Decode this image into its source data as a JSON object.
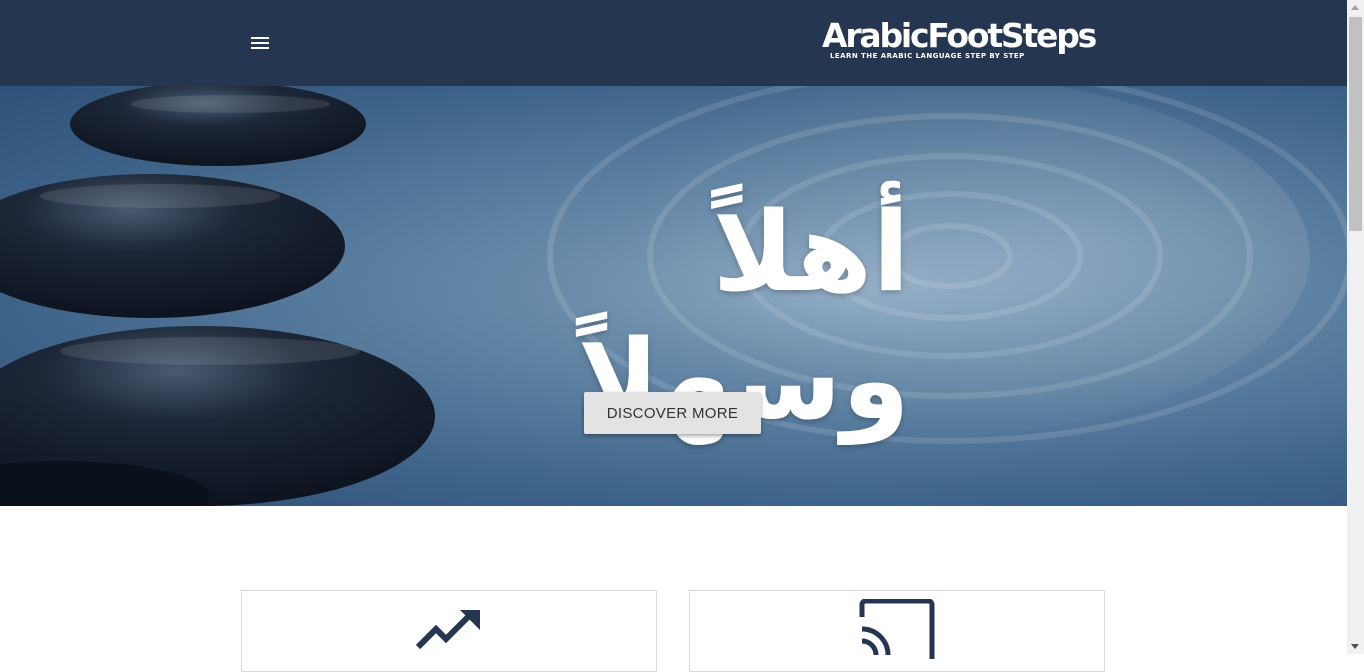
{
  "header": {
    "brand_name": "ArabicFootSteps",
    "brand_tagline": "LEARN THE ARABIC LANGUAGE STEP BY STEP",
    "menu_icon": "hamburger-menu-icon",
    "background_color": "#243650"
  },
  "hero": {
    "calligraphy": "أهلاً وسهلاً",
    "button_label": "DISCOVER MORE",
    "background_color": "#4f7396"
  },
  "cards": [
    {
      "icon": "trending-up-icon"
    },
    {
      "icon": "cast-icon"
    }
  ],
  "colors": {
    "icon": "#243650",
    "button_bg": "#e3e3e3"
  }
}
